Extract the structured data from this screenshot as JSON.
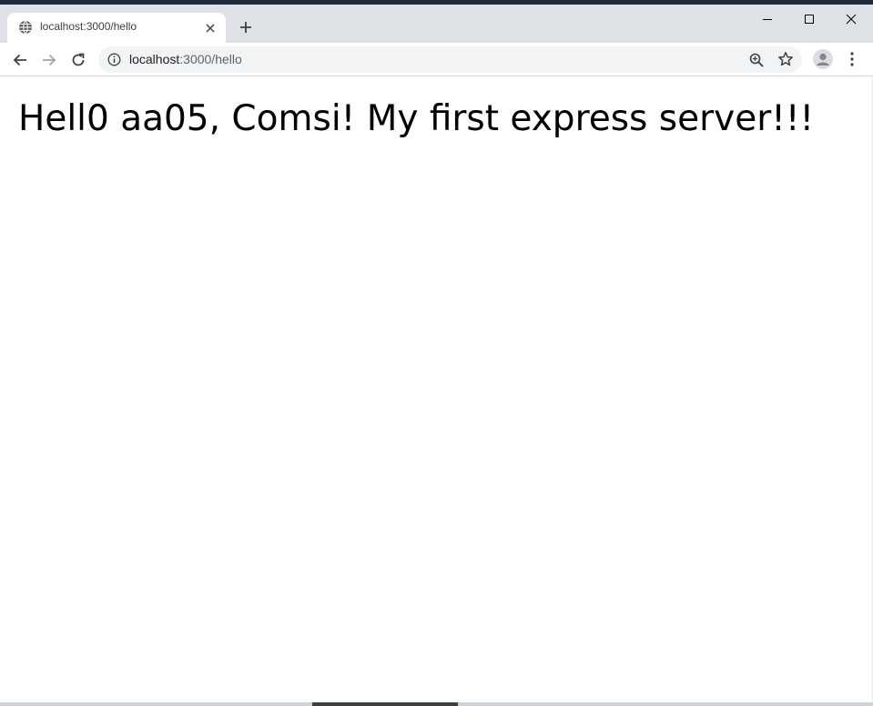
{
  "browser": {
    "tab": {
      "title": "localhost:3000/hello",
      "favicon": "globe-icon"
    },
    "new_tab_icon": "plus-icon",
    "window_controls": [
      "minimize-icon",
      "maximize-icon",
      "close-icon"
    ],
    "address_bar": {
      "host": "localhost",
      "path": ":3000/hello",
      "security_icon": "info-icon"
    },
    "toolbar_icons": [
      "back-icon",
      "forward-icon",
      "reload-icon",
      "zoom-icon",
      "star-icon",
      "profile-icon",
      "more-menu-icon"
    ]
  },
  "page": {
    "heading": "Hell0 aa05, Comsi! My first express server!!!"
  },
  "colors": {
    "titlebar": "#dee1e6",
    "omnibox": "#f1f3f4",
    "text": "#000000"
  }
}
